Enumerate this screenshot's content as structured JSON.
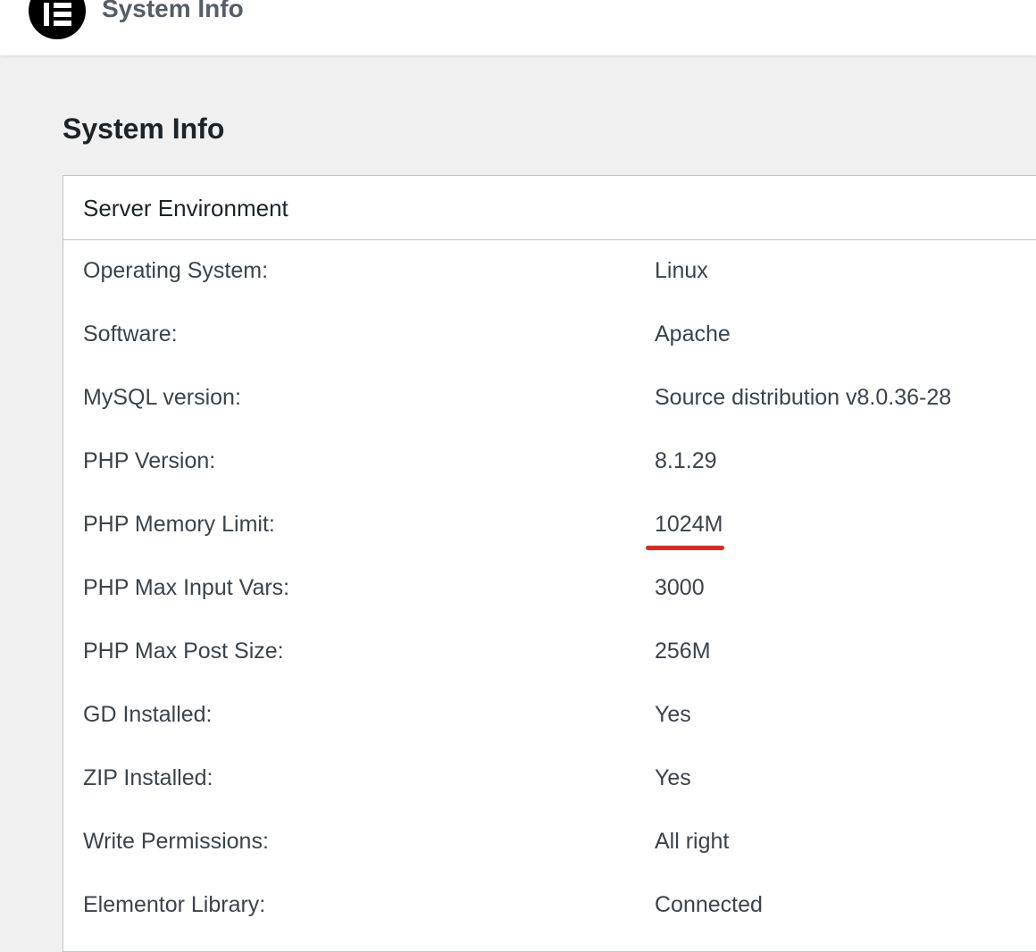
{
  "header": {
    "title": "System Info",
    "logo_icon": "elementor-logo-icon"
  },
  "page": {
    "heading": "System Info"
  },
  "panel": {
    "title": "Server Environment",
    "rows": [
      {
        "label": "Operating System:",
        "value": "Linux"
      },
      {
        "label": "Software:",
        "value": "Apache"
      },
      {
        "label": "MySQL version:",
        "value": "Source distribution v8.0.36-28"
      },
      {
        "label": "PHP Version:",
        "value": "8.1.29"
      },
      {
        "label": "PHP Memory Limit:",
        "value": "1024M"
      },
      {
        "label": "PHP Max Input Vars:",
        "value": "3000"
      },
      {
        "label": "PHP Max Post Size:",
        "value": "256M"
      },
      {
        "label": "GD Installed:",
        "value": "Yes"
      },
      {
        "label": "ZIP Installed:",
        "value": "Yes"
      },
      {
        "label": "Write Permissions:",
        "value": "All right"
      },
      {
        "label": "Elementor Library:",
        "value": "Connected"
      }
    ]
  },
  "colors": {
    "highlight_underline": "#e2261c",
    "background": "#f0f0f1",
    "panel_border": "#c3c4c7"
  }
}
